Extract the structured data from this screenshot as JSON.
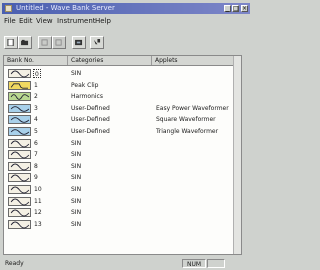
{
  "window": {
    "title": "Untitled - Wave Bank Server"
  },
  "menubar": {
    "file": "File",
    "edit": "Edit",
    "view": "View",
    "instrument": "Instrument",
    "help": "Help"
  },
  "title_buttons": {
    "min": "_",
    "max": "□",
    "close": "×"
  },
  "columns": {
    "bank": "Bank No.",
    "category": "Categories",
    "applets": "Applets"
  },
  "rows": [
    {
      "num": "0",
      "category": "SIN",
      "applet": "",
      "wave": "sine",
      "color": "#f4f0e4"
    },
    {
      "num": "1",
      "category": "Peak Clip",
      "applet": "",
      "wave": "clip",
      "color": "#f0d860"
    },
    {
      "num": "2",
      "category": "Harmonics",
      "applet": "",
      "wave": "harm",
      "color": "#b8d890"
    },
    {
      "num": "3",
      "category": "User-Defined",
      "applet": "Easy Power Waveformer",
      "wave": "user",
      "color": "#a8d0ea"
    },
    {
      "num": "4",
      "category": "User-Defined",
      "applet": "Square Waveformer",
      "wave": "user",
      "color": "#a8d0ea"
    },
    {
      "num": "5",
      "category": "User-Defined",
      "applet": "Triangle Waveformer",
      "wave": "user",
      "color": "#a8d0ea"
    },
    {
      "num": "6",
      "category": "SIN",
      "applet": "",
      "wave": "sine",
      "color": "#f4f0e4"
    },
    {
      "num": "7",
      "category": "SIN",
      "applet": "",
      "wave": "sine",
      "color": "#f4f0e4"
    },
    {
      "num": "8",
      "category": "SIN",
      "applet": "",
      "wave": "sine",
      "color": "#f4f0e4"
    },
    {
      "num": "9",
      "category": "SIN",
      "applet": "",
      "wave": "sine",
      "color": "#f4f0e4"
    },
    {
      "num": "10",
      "category": "SIN",
      "applet": "",
      "wave": "sine",
      "color": "#f4f0e4"
    },
    {
      "num": "11",
      "category": "SIN",
      "applet": "",
      "wave": "sine",
      "color": "#f4f0e4"
    },
    {
      "num": "12",
      "category": "SIN",
      "applet": "",
      "wave": "sine",
      "color": "#f4f0e4"
    },
    {
      "num": "13",
      "category": "SIN",
      "applet": "",
      "wave": "sine",
      "color": "#f4f0e4"
    }
  ],
  "status": {
    "text": "Ready",
    "num": "NUM"
  },
  "toolbar_icons": [
    "new-icon",
    "open-icon",
    "cut-icon",
    "copy-icon",
    "paste-icon",
    "help-icon"
  ]
}
